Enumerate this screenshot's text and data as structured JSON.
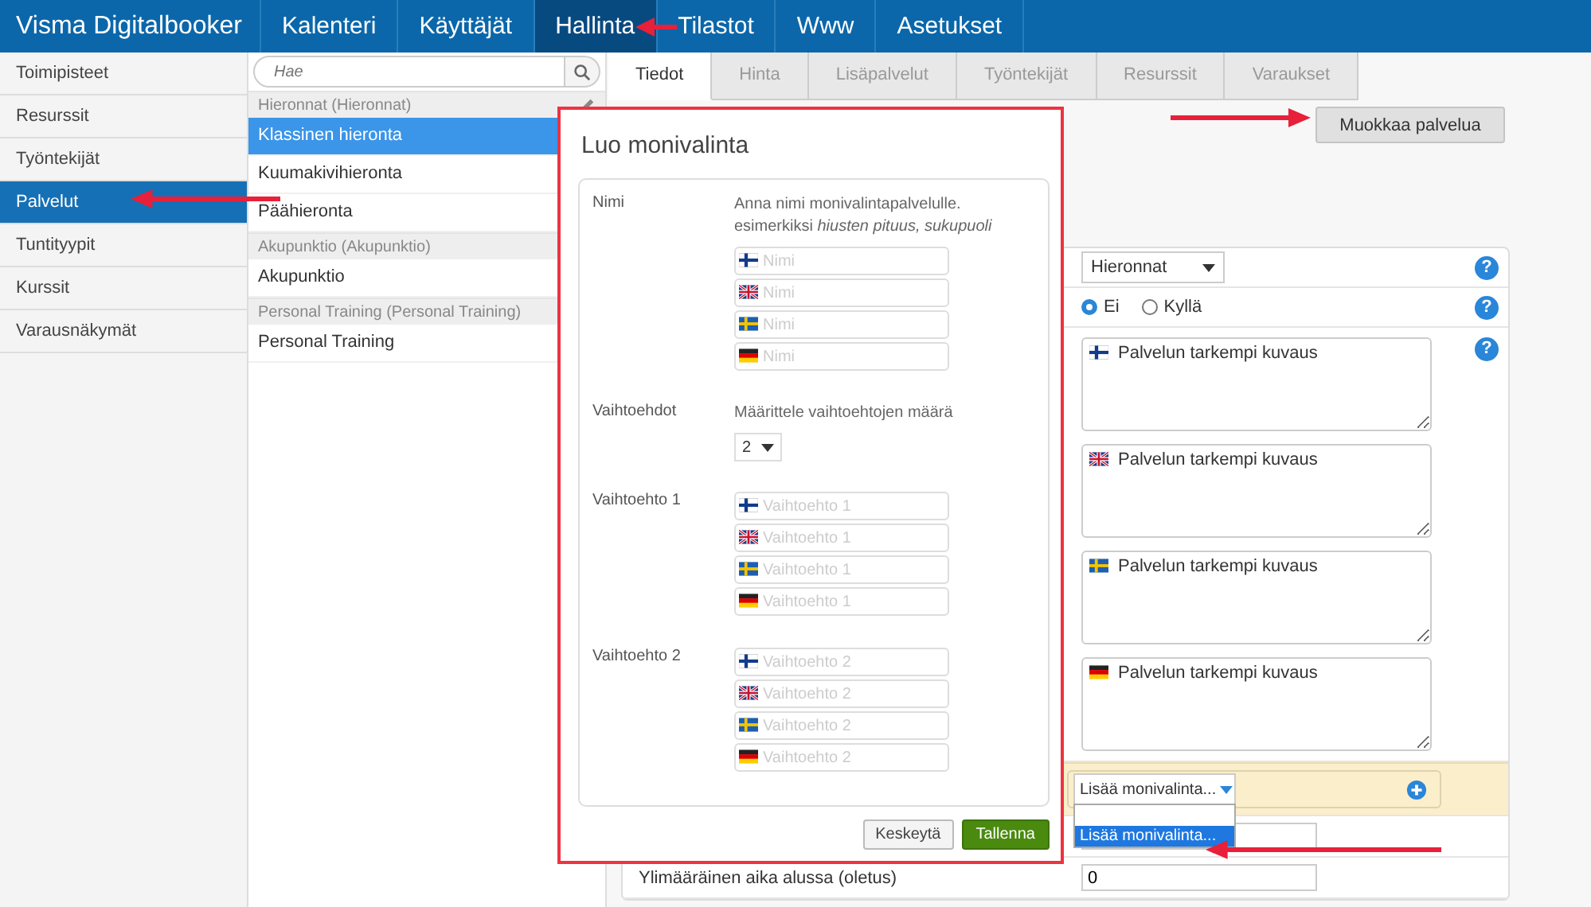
{
  "brand": "Visma Digitalbooker",
  "nav": [
    {
      "label": "Kalenteri",
      "selected": false
    },
    {
      "label": "Käyttäjät",
      "selected": false
    },
    {
      "label": "Hallinta",
      "selected": true
    },
    {
      "label": "Tilastot",
      "selected": false
    },
    {
      "label": "Www",
      "selected": false
    },
    {
      "label": "Asetukset",
      "selected": false
    }
  ],
  "sidebar": {
    "items": [
      {
        "label": "Toimipisteet",
        "selected": false
      },
      {
        "label": "Resurssit",
        "selected": false
      },
      {
        "label": "Työntekijät",
        "selected": false
      },
      {
        "label": "Palvelut",
        "selected": true
      },
      {
        "label": "Tuntityypit",
        "selected": false
      },
      {
        "label": "Kurssit",
        "selected": false
      },
      {
        "label": "Varausnäkymät",
        "selected": false
      }
    ]
  },
  "service_list": {
    "search": {
      "placeholder": "Hae"
    },
    "groups": [
      {
        "title": "Hieronnat (Hieronnat)",
        "items": [
          {
            "label": "Klassinen hieronta",
            "selected": true
          },
          {
            "label": "Kuumakivihieronta",
            "selected": false
          },
          {
            "label": "Päähieronta",
            "selected": false
          }
        ]
      },
      {
        "title": "Akupunktio (Akupunktio)",
        "items": [
          {
            "label": "Akupunktio",
            "selected": false
          }
        ]
      },
      {
        "title": "Personal Training (Personal Training)",
        "items": [
          {
            "label": "Personal Training",
            "selected": false
          }
        ]
      }
    ]
  },
  "tabs": [
    {
      "label": "Tiedot",
      "selected": true
    },
    {
      "label": "Hinta",
      "selected": false
    },
    {
      "label": "Lisäpalvelut",
      "selected": false
    },
    {
      "label": "Työntekijät",
      "selected": false
    },
    {
      "label": "Resurssit",
      "selected": false
    },
    {
      "label": "Varaukset",
      "selected": false
    }
  ],
  "edit_button": "Muokkaa palvelua",
  "form": {
    "category_select": {
      "value": "Hieronnat",
      "help": "?"
    },
    "radio": {
      "options": [
        {
          "label": "Ei",
          "selected": true
        },
        {
          "label": "Kyllä",
          "selected": false
        }
      ],
      "help": "?"
    },
    "descriptions_help": "?",
    "descriptions": [
      {
        "kind": "fi",
        "placeholder": "Palvelun tarkempi kuvaus"
      },
      {
        "kind": "gb",
        "placeholder": "Palvelun tarkempi kuvaus"
      },
      {
        "kind": "se",
        "placeholder": "Palvelun tarkempi kuvaus"
      },
      {
        "kind": "de",
        "placeholder": "Palvelun tarkempi kuvaus"
      }
    ],
    "multichoice": {
      "value": "Lisää monivalinta...",
      "expanded": true,
      "options": [
        {
          "label": "Lisää monivalinta...",
          "selected": true
        }
      ]
    },
    "extra_time": {
      "label": "Ylimääräinen aika alussa (oletus)",
      "value": "0"
    }
  },
  "modal": {
    "title": "Luo monivalinta",
    "sections": [
      {
        "kind": "fields",
        "label": "Nimi",
        "hint": [
          "Anna nimi monivalintapalvelulle.",
          "esimerkiksi *hiusten pituus, sukupuoli*"
        ],
        "fields": [
          {
            "kind": "fi",
            "placeholder": "Nimi"
          },
          {
            "kind": "gb",
            "placeholder": "Nimi"
          },
          {
            "kind": "se",
            "placeholder": "Nimi"
          },
          {
            "kind": "de",
            "placeholder": "Nimi"
          }
        ]
      },
      {
        "kind": "count",
        "label": "Vaihtoehdot",
        "hint": [
          "Määrittele vaihtoehtojen määrä"
        ],
        "value": "2"
      },
      {
        "kind": "fields",
        "label": "Vaihtoehto 1",
        "fields": [
          {
            "kind": "fi",
            "placeholder": "Vaihtoehto 1"
          },
          {
            "kind": "gb",
            "placeholder": "Vaihtoehto 1"
          },
          {
            "kind": "se",
            "placeholder": "Vaihtoehto 1"
          },
          {
            "kind": "de",
            "placeholder": "Vaihtoehto 1"
          }
        ]
      },
      {
        "kind": "fields",
        "label": "Vaihtoehto 2",
        "fields": [
          {
            "kind": "fi",
            "placeholder": "Vaihtoehto 2"
          },
          {
            "kind": "gb",
            "placeholder": "Vaihtoehto 2"
          },
          {
            "kind": "se",
            "placeholder": "Vaihtoehto 2"
          },
          {
            "kind": "de",
            "placeholder": "Vaihtoehto 2"
          }
        ]
      }
    ],
    "buttons": [
      {
        "kind": "cancel",
        "label": "Keskeytä"
      },
      {
        "kind": "save",
        "label": "Tallenna"
      }
    ]
  }
}
